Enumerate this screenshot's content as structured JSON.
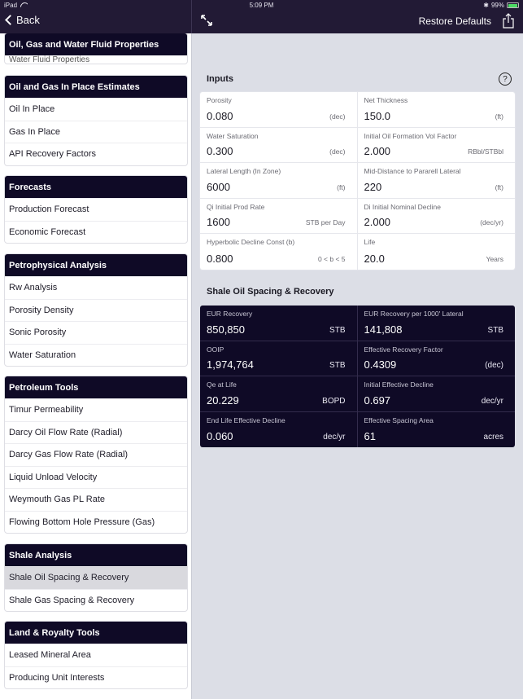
{
  "status_bar": {
    "device": "iPad",
    "time": "5:09 PM",
    "battery_percent": "99%",
    "battery_level": 0.99
  },
  "nav": {
    "back_label": "Back",
    "restore_label": "Restore Defaults",
    "icons": [
      "chevron-left-icon",
      "expand-icon",
      "share-icon"
    ]
  },
  "sidebar": {
    "groups": [
      {
        "title": "Oil, Gas and Water Fluid Properties",
        "items": [
          "Water Fluid Properties"
        ]
      },
      {
        "title": "Oil and Gas In Place Estimates",
        "items": [
          "Oil In Place",
          "Gas In Place",
          "API Recovery Factors"
        ]
      },
      {
        "title": "Forecasts",
        "items": [
          "Production Forecast",
          "Economic Forecast"
        ]
      },
      {
        "title": "Petrophysical Analysis",
        "items": [
          "Rw Analysis",
          "Porosity Density",
          "Sonic Porosity",
          "Water Saturation"
        ]
      },
      {
        "title": "Petroleum Tools",
        "items": [
          "Timur Permeability",
          "Darcy Oil Flow Rate (Radial)",
          "Darcy Gas Flow Rate (Radial)",
          "Liquid Unload Velocity",
          "Weymouth Gas PL Rate",
          "Flowing Bottom Hole Pressure (Gas)"
        ]
      },
      {
        "title": "Shale Analysis",
        "items": [
          "Shale Oil Spacing & Recovery",
          "Shale Gas Spacing & Recovery"
        ],
        "selected": "Shale Oil Spacing & Recovery"
      },
      {
        "title": "Land & Royalty Tools",
        "items": [
          "Leased Mineral Area",
          "Producing Unit Interests"
        ]
      }
    ]
  },
  "inputs": {
    "title": "Inputs",
    "help_label": "?",
    "fields": [
      {
        "label": "Porosity",
        "value": "0.080",
        "unit": "(dec)"
      },
      {
        "label": "Net Thickness",
        "value": "150.0",
        "unit": "(ft)"
      },
      {
        "label": "Water Saturation",
        "value": "0.300",
        "unit": "(dec)"
      },
      {
        "label": "Initial Oil Formation Vol Factor",
        "value": "2.000",
        "unit": "RBbl/STBbl"
      },
      {
        "label": "Lateral Length (In Zone)",
        "value": "6000",
        "unit": "(ft)"
      },
      {
        "label": "Mid-Distance to Pararell Lateral",
        "value": "220",
        "unit": "(ft)"
      },
      {
        "label": "Qi Initial Prod Rate",
        "value": "1600",
        "unit": "STB per Day"
      },
      {
        "label": "Di Initial Nominal Decline",
        "value": "2.000",
        "unit": "(dec/yr)"
      },
      {
        "label": "Hyperbolic Decline Const (b)",
        "value": "0.800",
        "unit": "0 < b < 5"
      },
      {
        "label": "Life",
        "value": "20.0",
        "unit": "Years"
      }
    ]
  },
  "results": {
    "title": "Shale Oil Spacing & Recovery",
    "fields": [
      {
        "label": "EUR Recovery",
        "value": "850,850",
        "unit": "STB"
      },
      {
        "label": "EUR Recovery per 1000' Lateral",
        "value": "141,808",
        "unit": "STB"
      },
      {
        "label": "OOIP",
        "value": "1,974,764",
        "unit": "STB"
      },
      {
        "label": "Effective Recovery Factor",
        "value": "0.4309",
        "unit": "(dec)"
      },
      {
        "label": "Qe at Life",
        "value": "20.229",
        "unit": "BOPD"
      },
      {
        "label": "Initial Effective Decline",
        "value": "0.697",
        "unit": "dec/yr"
      },
      {
        "label": "End Life Effective Decline",
        "value": "0.060",
        "unit": "dec/yr"
      },
      {
        "label": "Effective Spacing Area",
        "value": "61",
        "unit": "acres"
      }
    ]
  },
  "colors": {
    "nav_bar": "#221a35",
    "section_header": "#0f0a26",
    "background": "#dcdee6",
    "selected_row": "#d9d9de",
    "battery": "#4cd964"
  }
}
